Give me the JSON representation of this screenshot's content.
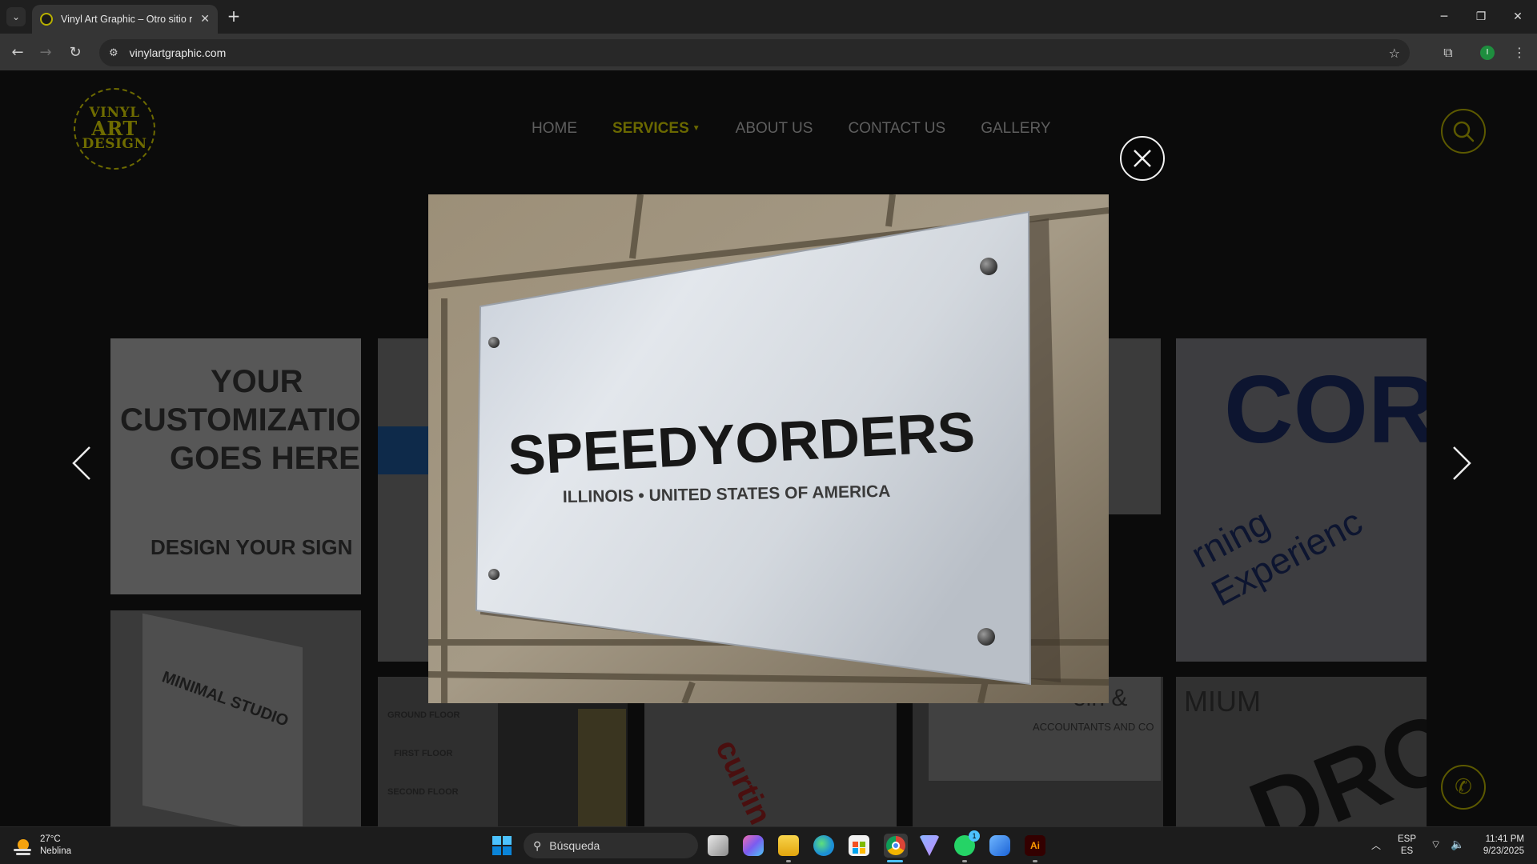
{
  "browser": {
    "tab_title": "Vinyl Art Graphic – Otro sitio re",
    "url": "vinylartgraphic.com"
  },
  "site": {
    "logo": [
      "VINYL",
      "ART",
      "DESIGN"
    ],
    "nav": [
      {
        "label": "HOME"
      },
      {
        "label": "SERVICES"
      },
      {
        "label": "ABOUT US"
      },
      {
        "label": "CONTACT US"
      },
      {
        "label": "GALLERY"
      }
    ],
    "active_nav": "SERVICES",
    "tiles": {
      "custom_1": "YOUR",
      "custom_2": "CUSTOMIZATIO",
      "custom_3": "GOES HERE",
      "custom_4": "DESIGN YOUR SIGN",
      "minimal": "MINIMAL STUDIO",
      "floor_1": "GROUND FLOOR",
      "floor_2": "FIRST FLOOR",
      "floor_3": "SECOND FLOOR",
      "curtin": "curtin",
      "accountants_1": "ein &",
      "accountants_2": "ACCOUNTANTS AND CO",
      "mium": "MIUM",
      "experience": "rning Experienc",
      "cor": "COR",
      "dro": "DRO"
    }
  },
  "lightbox": {
    "sign_title": "SPEEDYORDERS",
    "sign_subtitle": "ILLINOIS • UNITED STATES OF AMERICA"
  },
  "taskbar": {
    "temperature": "27°C",
    "condition": "Neblina",
    "search_placeholder": "Búsqueda",
    "lang_1": "ESP",
    "lang_2": "ES",
    "time": "11:41 PM",
    "date": "9/23/2025",
    "whatsapp_badge": "1"
  },
  "colors": {
    "accent_olive": "#6a6800",
    "chrome_dark": "#1f1f1f",
    "overlay": "#0b0b0b"
  }
}
